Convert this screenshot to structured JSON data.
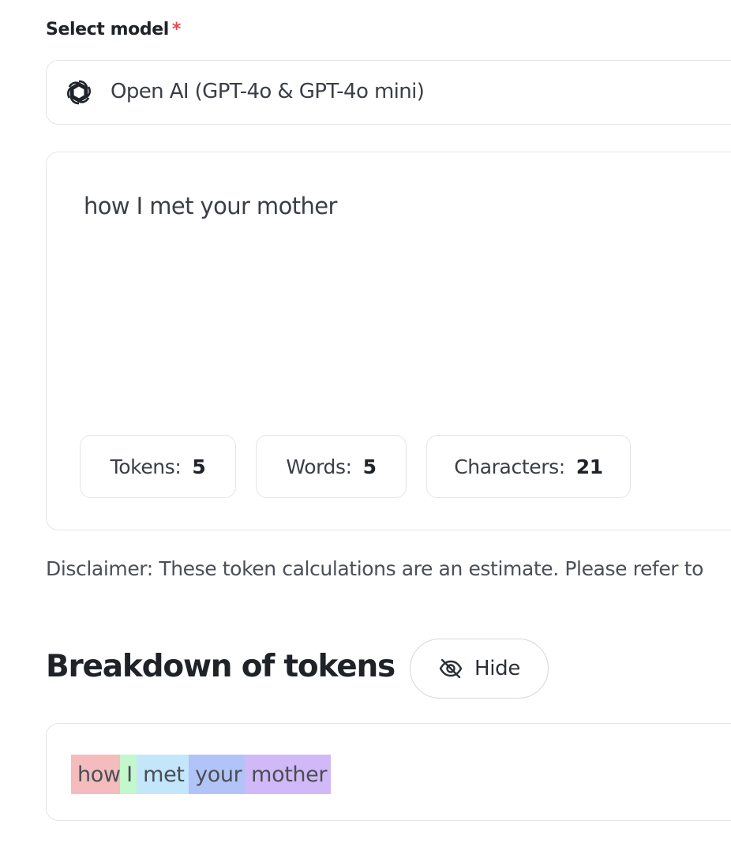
{
  "select": {
    "label": "Select model",
    "required_mark": "*",
    "selected_model": "Open AI (GPT-4o & GPT-4o mini)",
    "icon": "openai-icon"
  },
  "input": {
    "value": "how I met your mother"
  },
  "stats": {
    "tokens_label": "Tokens:",
    "tokens_value": "5",
    "words_label": "Words:",
    "words_value": "5",
    "characters_label": "Characters:",
    "characters_value": "21"
  },
  "disclaimer": "Disclaimer: These token calculations are an estimate. Please refer to",
  "breakdown": {
    "title": "Breakdown of tokens",
    "hide_label": "Hide",
    "hide_icon": "eye-off-icon",
    "tokens": [
      {
        "text": "how",
        "color": "#f4bcbc"
      },
      {
        "text": " I",
        "color": "#c3f7cc"
      },
      {
        "text": " met",
        "color": "#c3e6fb"
      },
      {
        "text": " your",
        "color": "#b2c3f7"
      },
      {
        "text": " mother",
        "color": "#d1b9f7"
      }
    ]
  },
  "colors": {
    "required": "#e5484d",
    "border": "#e3e5e8"
  }
}
